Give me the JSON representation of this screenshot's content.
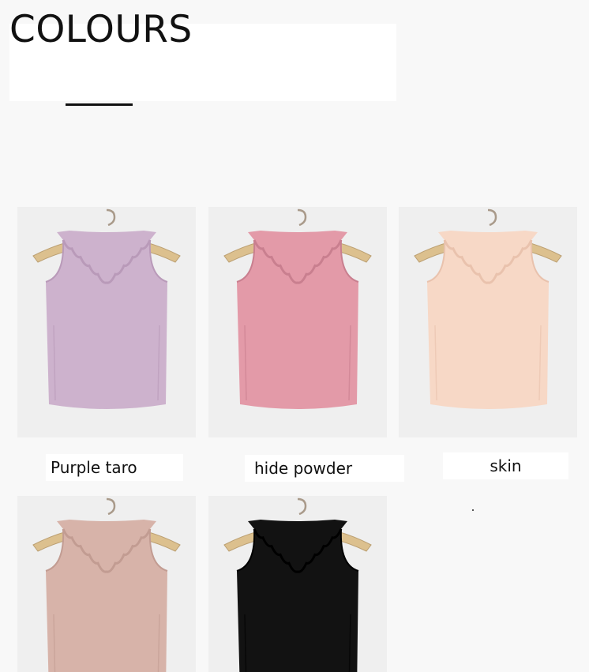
{
  "header": {
    "title": "COLOURS"
  },
  "products": [
    {
      "label": "Purple taro",
      "color": "#cdb2cd",
      "shade": "#b99ab9",
      "icon": "tank-top-on-hanger-icon"
    },
    {
      "label": "hide powder",
      "color": "#e39aa8",
      "shade": "#c97f8f",
      "icon": "tank-top-on-hanger-icon"
    },
    {
      "label": "skin",
      "color": "#f7d8c6",
      "shade": "#e9c2ad",
      "icon": "tank-top-on-hanger-icon"
    },
    {
      "label": "",
      "color": "#d7b3a9",
      "shade": "#c29c92",
      "icon": "tank-top-on-hanger-icon"
    },
    {
      "label": "",
      "color": "#121212",
      "shade": "#000000",
      "icon": "tank-top-on-hanger-icon"
    }
  ]
}
